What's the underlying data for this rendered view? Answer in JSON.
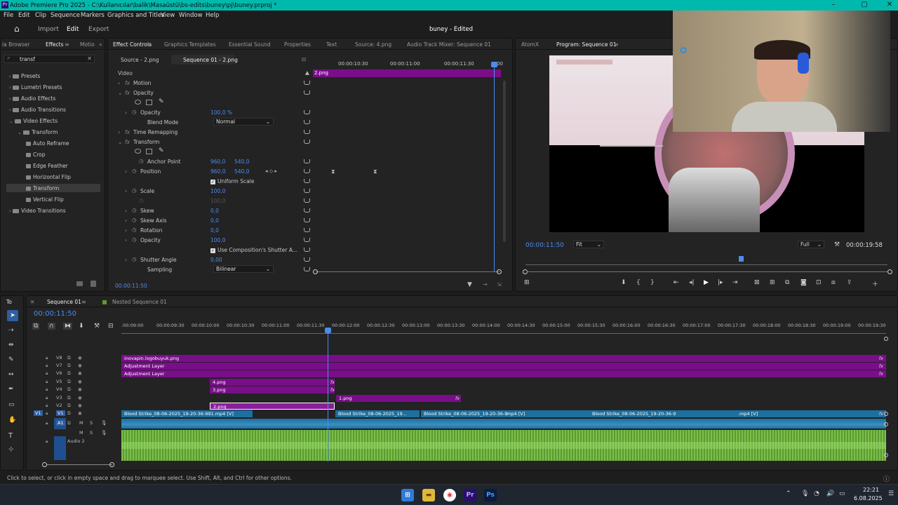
{
  "app": {
    "title": "Adobe Premiere Pro 2025 - C:\\Kullanıcılar\\balik\\Masaüstü\\bs-edits\\buney\\pj\\buney.prproj *",
    "project_status": "buney - Edited"
  },
  "menu": [
    "File",
    "Edit",
    "Clip",
    "Sequence",
    "Markers",
    "Graphics and Titles",
    "View",
    "Window",
    "Help"
  ],
  "workspace": {
    "home": "home-icon",
    "import": "Import",
    "edit": "Edit",
    "export": "Export"
  },
  "effects_panel": {
    "tabs": [
      "ia Browser",
      "Effects",
      "Motio"
    ],
    "search_value": "transf",
    "tree": [
      {
        "label": "Presets",
        "level": 0,
        "open": false
      },
      {
        "label": "Lumetri Presets",
        "level": 0,
        "open": false
      },
      {
        "label": "Audio Effects",
        "level": 0,
        "open": false
      },
      {
        "label": "Audio Transitions",
        "level": 0,
        "open": false
      },
      {
        "label": "Video Effects",
        "level": 0,
        "open": true
      },
      {
        "label": "Transform",
        "level": 1,
        "open": true
      },
      {
        "label": "Auto Reframe",
        "level": 2
      },
      {
        "label": "Crop",
        "level": 2
      },
      {
        "label": "Edge Feather",
        "level": 2
      },
      {
        "label": "Horizontal Flip",
        "level": 2
      },
      {
        "label": "Transform",
        "level": 2,
        "selected": true
      },
      {
        "label": "Vertical Flip",
        "level": 2
      },
      {
        "label": "Video Transitions",
        "level": 0,
        "open": false
      }
    ]
  },
  "effect_controls": {
    "tabs": [
      "Effect Controls",
      "Graphics Templates",
      "Essential Sound",
      "Properties",
      "Text",
      "Source: 4.png",
      "Audio Track Mixer: Sequence 01"
    ],
    "source_tab": "Source - 2.png",
    "seq_tab": "Sequence 01 - 2.png",
    "section": "Video",
    "ruler": [
      "00:00:10:30",
      "00:00:11:00",
      "00:00:11:30",
      "00"
    ],
    "clip_label": "2.png",
    "rows": {
      "motion": "Motion",
      "opacity_group": "Opacity",
      "opacity": "Opacity",
      "opacity_val": "100,0 %",
      "blend": "Blend Mode",
      "blend_val": "Normal",
      "time_remap": "Time Remapping",
      "transform": "Transform",
      "anchor": "Anchor Point",
      "anchor_x": "960,0",
      "anchor_y": "540,0",
      "position": "Position",
      "pos_x": "960,0",
      "pos_y": "540,0",
      "uniform": "Uniform Scale",
      "scale": "Scale",
      "scale_val": "100,0",
      "scale_w": "100,0",
      "skew": "Skew",
      "skew_val": "0,0",
      "skew_axis": "Skew Axis",
      "skew_axis_val": "0,0",
      "rotation": "Rotation",
      "rotation_val": "0,0",
      "opacity2": "Opacity",
      "opacity2_val": "100,0",
      "shutter_comp": "Use Composition's Shutter A...",
      "shutter_angle": "Shutter Angle",
      "shutter_val": "0,00",
      "sampling": "Sampling",
      "sampling_val": "Bilinear"
    },
    "timecode": "00:00:11:50"
  },
  "program": {
    "tabs": [
      "AtomX",
      "Program: Sequence 01"
    ],
    "timecode": "00:00:11:50",
    "fit": "Fit",
    "quality": "Full",
    "duration": "00:00:19:58"
  },
  "tools_tab": "To",
  "timeline": {
    "tabs": [
      "Sequence 01",
      "Nested Sequence 01"
    ],
    "timecode": "00:00:11:50",
    "ruler": [
      ":00:09:00",
      "00:00:09:30",
      "00:00:10:00",
      "00:00:10:30",
      "00:00:11:00",
      "00:00:11:30",
      "00:00:12:00",
      "00:00:12:30",
      "00:00:13:00",
      "00:00:13:30",
      "00:00:14:00",
      "00:00:14:30",
      "00:00:15:00",
      "00:00:15:30",
      "00:00:16:00",
      "00:00:16:30",
      "00:00:17:00",
      "00:00:17:30",
      "00:00:18:00",
      "00:00:18:30",
      "00:00:19:00",
      "00:00:19:30"
    ],
    "tracks": [
      "V8",
      "V7",
      "V6",
      "V5",
      "V4",
      "V3",
      "V2",
      "V1",
      "A1",
      "Audio 2"
    ],
    "track_src_v": "V1",
    "track_src_a": "A1",
    "clips": {
      "v8": "inovapin.logobuyuk.png",
      "v7": "Adjustment Layer",
      "v6": "Adjustment Layer",
      "v5": "4.png",
      "v4": "3.png",
      "v3": "1.png",
      "v2": "2.png",
      "v1a": "Blood Strike_08-06-2025_19-20-36-991.mp4 [V]",
      "v1b": "Blood Strike_08-06-2025_19...",
      "v1c": "Blood Strike_08-06-2025_19-20-36-9",
      "v1c2": ".mp4 [V]",
      "v1d": "Blood Strike_08-06-2025_19-20-36-9",
      "v1d2": ".mp4 [V]"
    },
    "fx": "fx"
  },
  "status_bar": "Click to select, or click in empty space and drag to marquee select. Use Shift, Alt, and Ctrl for other options.",
  "taskbar": {
    "time": "22:21",
    "date": "6.08.2025",
    "pr": "Pr",
    "ps": "Ps"
  }
}
